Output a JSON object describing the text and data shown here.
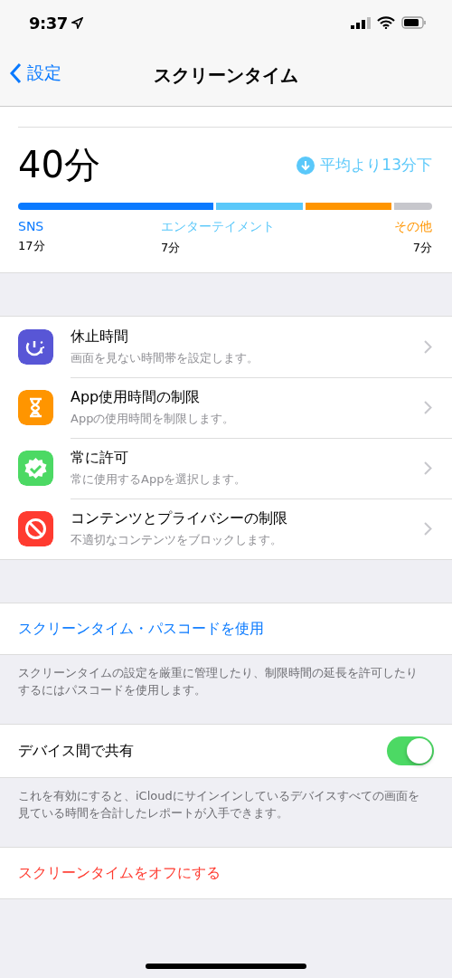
{
  "status_bar": {
    "time": "9:37"
  },
  "nav": {
    "back": "設定",
    "title": "スクリーンタイム"
  },
  "summary": {
    "total": "40分",
    "comparison": "平均より13分下",
    "segments": [
      {
        "color": "#0a7aff"
      },
      {
        "color": "#5ac8fa"
      },
      {
        "color": "#ff9500"
      },
      {
        "color": "#c7c7cc"
      }
    ],
    "categories": [
      {
        "name": "SNS",
        "time": "17分"
      },
      {
        "name": "エンターテイメント",
        "time": "7分"
      },
      {
        "name": "その他",
        "time": "7分"
      }
    ]
  },
  "features": [
    {
      "kind": "downtime",
      "color": "#5856d6",
      "title": "休止時間",
      "subtitle": "画面を見ない時間帯を設定します。"
    },
    {
      "kind": "limits",
      "color": "#ff9500",
      "title": "App使用時間の制限",
      "subtitle": "Appの使用時間を制限します。"
    },
    {
      "kind": "allowed",
      "color": "#4cd964",
      "title": "常に許可",
      "subtitle": "常に使用するAppを選択します。"
    },
    {
      "kind": "restrictions",
      "color": "#ff3b30",
      "title": "コンテンツとプライバシーの制限",
      "subtitle": "不適切なコンテンツをブロックします。"
    }
  ],
  "passcode": {
    "label": "スクリーンタイム・パスコードを使用",
    "footer": "スクリーンタイムの設定を厳重に管理したり、制限時間の延長を許可したりするにはパスコードを使用します。"
  },
  "share": {
    "label": "デバイス間で共有",
    "on": true,
    "footer": "これを有効にすると、iCloudにサインインしているデバイスすべての画面を見ている時間を合計したレポートが入手できます。"
  },
  "turn_off": {
    "label": "スクリーンタイムをオフにする"
  }
}
